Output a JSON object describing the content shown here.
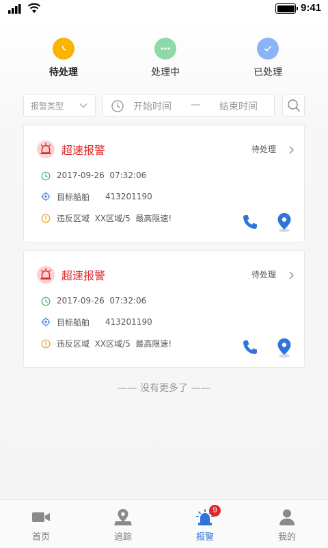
{
  "status_bar": {
    "time": "9:41"
  },
  "status_tabs": [
    {
      "label": "待处理",
      "icon": "clock-icon",
      "color": "#f7b500",
      "active": true
    },
    {
      "label": "处理中",
      "icon": "more-dots-icon",
      "color": "#8fd9a8",
      "active": false
    },
    {
      "label": "已处理",
      "icon": "checkmark-icon",
      "color": "#8ab4f8",
      "active": false
    }
  ],
  "filters": {
    "type_placeholder": "报警类型",
    "start_placeholder": "开始时间",
    "range_separator": "—",
    "end_placeholder": "结束时间"
  },
  "alerts": [
    {
      "title": "超速报警",
      "status": "待处理",
      "time": "2017-09-26  07:32:06",
      "target_label": "目标船舶",
      "target_value": "413201190",
      "violation": "违反区域  XX区域/5  最高限速!"
    },
    {
      "title": "超速报警",
      "status": "待处理",
      "time": "2017-09-26  07:32:06",
      "target_label": "目标船舶",
      "target_value": "413201190",
      "violation": "违反区域  XX区域/5  最高限速!"
    }
  ],
  "list_end": "—— 没有更多了 ——",
  "tabbar": {
    "items": [
      {
        "label": "首页",
        "icon": "video-camera-icon",
        "active": false
      },
      {
        "label": "追踪",
        "icon": "map-pin-icon",
        "active": false
      },
      {
        "label": "报警",
        "icon": "siren-icon",
        "active": true,
        "badge": "9"
      },
      {
        "label": "我的",
        "icon": "user-icon",
        "active": false
      }
    ]
  },
  "colors": {
    "accent": "#2f74db",
    "alert_red": "#e0282a",
    "time_icon": "#3ab37a",
    "target_icon": "#3b7be0",
    "warn_icon": "#f0a020"
  }
}
